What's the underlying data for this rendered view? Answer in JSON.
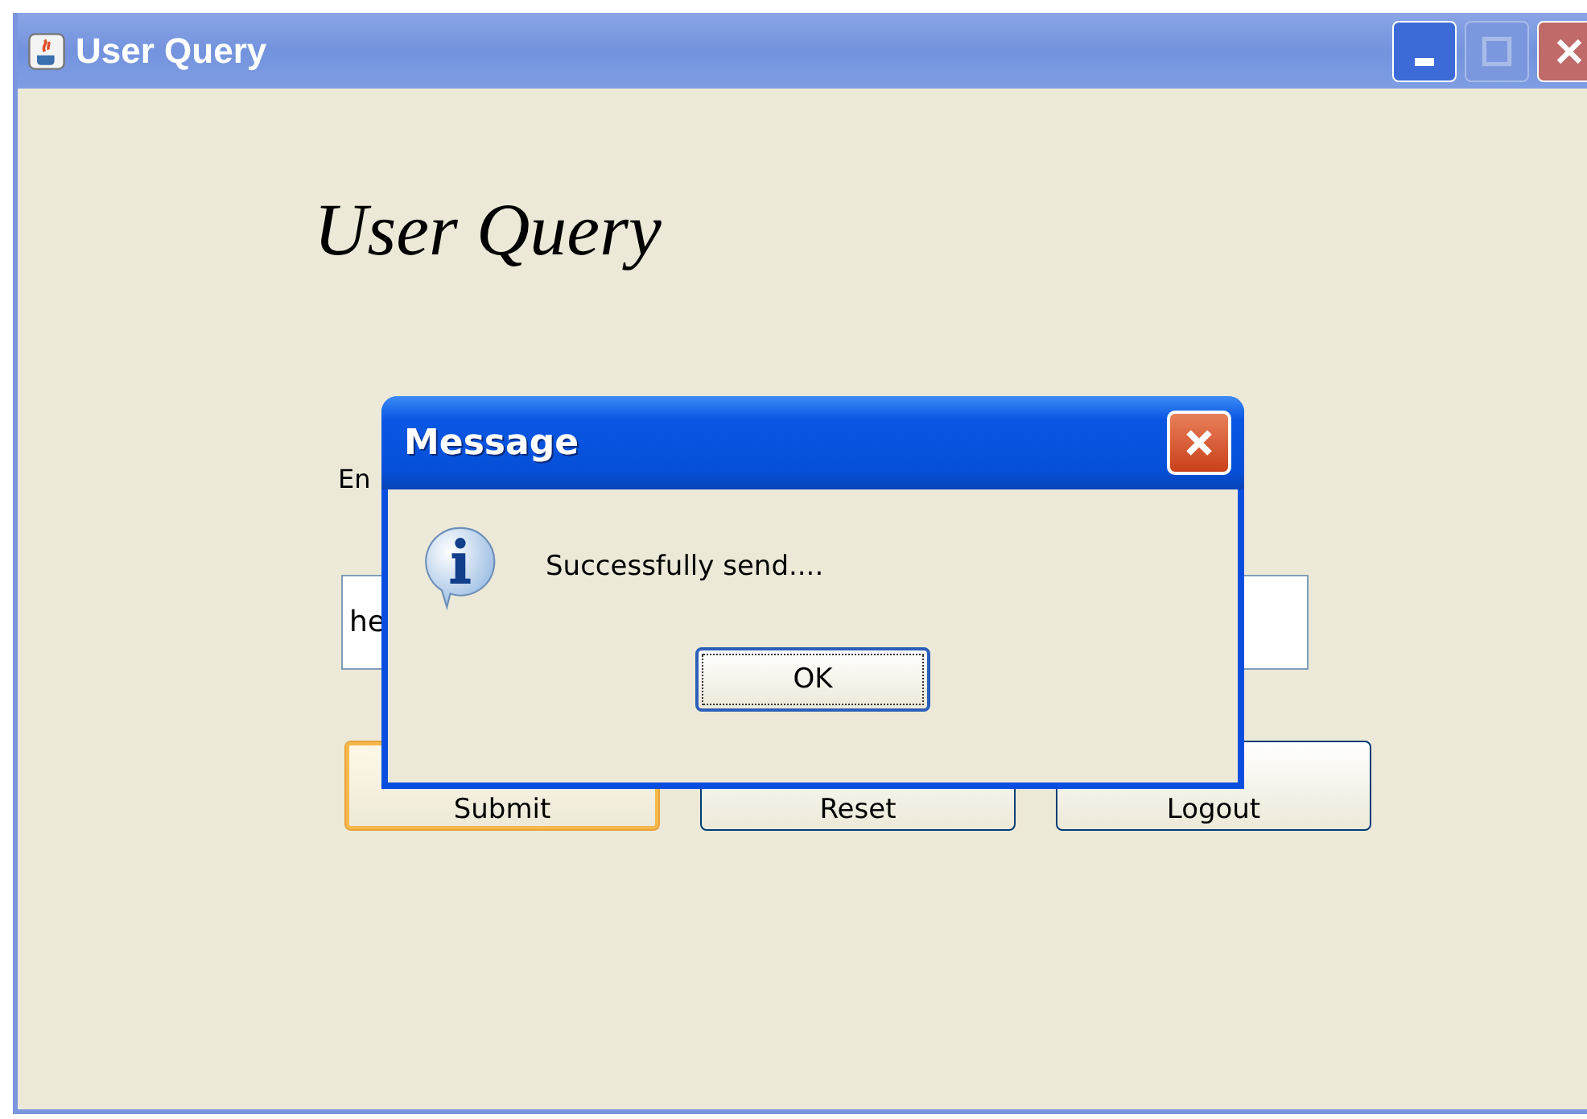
{
  "window": {
    "title": "User Query"
  },
  "heading": "User Query",
  "label": "En",
  "text_field": {
    "value": "he"
  },
  "buttons": [
    {
      "label": "Submit",
      "focused": true
    },
    {
      "label": "Reset",
      "focused": false
    },
    {
      "label": "Logout",
      "focused": false
    }
  ],
  "dialog": {
    "title": "Message",
    "message": "Successfully send....",
    "button": "OK"
  }
}
